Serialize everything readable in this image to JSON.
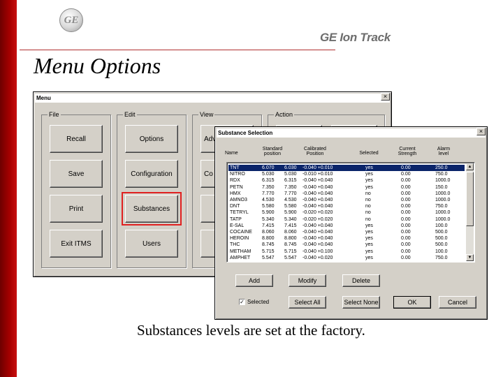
{
  "brand": {
    "logo_text": "GE",
    "company": "GE Ion Track"
  },
  "page": {
    "title": "Menu Options",
    "caption": "Substances levels are set at the factory."
  },
  "menu_window": {
    "title": "Menu",
    "close_glyph": "×",
    "groups": [
      {
        "label": "File",
        "buttons": [
          "Recall",
          "Save",
          "Print",
          "Exit ITMS"
        ]
      },
      {
        "label": "Edit",
        "buttons": [
          "Options",
          "Configuration",
          "Substances",
          "Users"
        ]
      },
      {
        "label": "View",
        "buttons": [
          "Adv",
          "Co"
        ]
      },
      {
        "label": "Action"
      }
    ],
    "highlighted": "Substances"
  },
  "substance_dialog": {
    "title": "Substance Selection",
    "close_glyph": "×",
    "columns": [
      "Name",
      "Standard position",
      "Calibrated Position",
      "Selected",
      "Current Strength",
      "Alarm level"
    ],
    "rows": [
      {
        "name": "TNT",
        "standard": "6.070",
        "calibrated": "6.030",
        "window": "-0.040 +0.010",
        "selected": "yes",
        "strength": "0.00",
        "alarm": "250.0"
      },
      {
        "name": "NITRO",
        "standard": "5.030",
        "calibrated": "5.030",
        "window": "-0.010 +0.010",
        "selected": "yes",
        "strength": "0.00",
        "alarm": "750.0"
      },
      {
        "name": "RDX",
        "standard": "6.315",
        "calibrated": "6.315",
        "window": "-0.040 +0.040",
        "selected": "yes",
        "strength": "0.00",
        "alarm": "1000.0"
      },
      {
        "name": "PETN",
        "standard": "7.350",
        "calibrated": "7.350",
        "window": "-0.040 +0.040",
        "selected": "yes",
        "strength": "0.00",
        "alarm": "150.0"
      },
      {
        "name": "HMX",
        "standard": "7.770",
        "calibrated": "7.770",
        "window": "-0.040 +0.040",
        "selected": "no",
        "strength": "0.00",
        "alarm": "1000.0"
      },
      {
        "name": "AMNO3",
        "standard": "4.530",
        "calibrated": "4.530",
        "window": "-0.040 +0.040",
        "selected": "no",
        "strength": "0.00",
        "alarm": "1000.0"
      },
      {
        "name": "DNT",
        "standard": "5.580",
        "calibrated": "5.580",
        "window": "-0.040 +0.040",
        "selected": "no",
        "strength": "0.00",
        "alarm": "750.0"
      },
      {
        "name": "TETRYL",
        "standard": "5.900",
        "calibrated": "5.900",
        "window": "-0.020 +0.020",
        "selected": "no",
        "strength": "0.00",
        "alarm": "1000.0"
      },
      {
        "name": "TATP",
        "standard": "5.340",
        "calibrated": "5.340",
        "window": "-0.020 +0.020",
        "selected": "no",
        "strength": "0.00",
        "alarm": "1000.0"
      },
      {
        "name": "E-SAL",
        "standard": "7.415",
        "calibrated": "7.415",
        "window": "-0.040 +0.040",
        "selected": "yes",
        "strength": "0.00",
        "alarm": "100.0"
      },
      {
        "name": "COCAINE",
        "standard": "8.060",
        "calibrated": "8.060",
        "window": "-0.040 +0.040",
        "selected": "yes",
        "strength": "0.00",
        "alarm": "500.0"
      },
      {
        "name": "HEROIN",
        "standard": "8.800",
        "calibrated": "8.800",
        "window": "-0.040 +0.040",
        "selected": "yes",
        "strength": "0.00",
        "alarm": "500.0"
      },
      {
        "name": "THC",
        "standard": "8.745",
        "calibrated": "8.745",
        "window": "-0.040 +0.040",
        "selected": "yes",
        "strength": "0.00",
        "alarm": "500.0"
      },
      {
        "name": "METHAM",
        "standard": "5.715",
        "calibrated": "5.715",
        "window": "-0.040 +0.100",
        "selected": "yes",
        "strength": "0.00",
        "alarm": "100.0"
      },
      {
        "name": "AMPHET",
        "standard": "5.547",
        "calibrated": "5.547",
        "window": "-0.040 +0.020",
        "selected": "yes",
        "strength": "0.00",
        "alarm": "750.0"
      }
    ],
    "selected_row": 0,
    "buttons": {
      "add": "Add",
      "modify": "Modify",
      "delete": "Delete",
      "select_all": "Select All",
      "select_none": "Select None",
      "ok": "OK",
      "cancel": "Cancel"
    },
    "checkbox": {
      "label": "Selected",
      "checked_glyph": "✓"
    }
  }
}
